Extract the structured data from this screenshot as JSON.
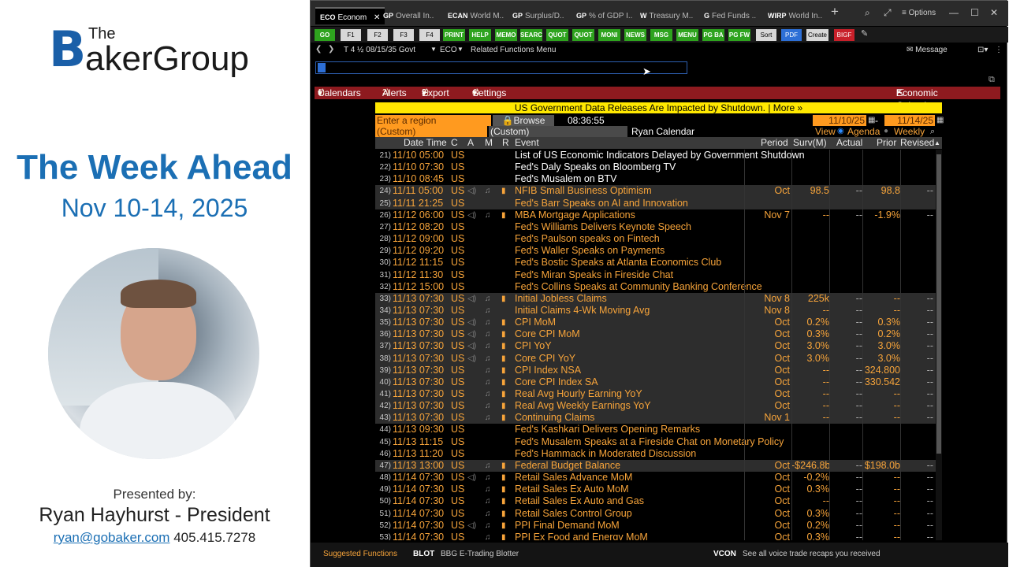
{
  "presentation": {
    "logo_the": "The",
    "logo_b": "B",
    "logo_rest": "akerGroup",
    "title": "The Week Ahead",
    "dates": "Nov 10-14, 2025",
    "presented_by": "Presented by:",
    "presenter": "Ryan Hayhurst - President",
    "email": "ryan@gobaker.com",
    "phone": "405.415.7278"
  },
  "tabs": [
    {
      "code": "ECO",
      "label": "Econom"
    },
    {
      "code": "GP",
      "label": "Overall In.."
    },
    {
      "code": "ECAN",
      "label": "World M.."
    },
    {
      "code": "GP",
      "label": "Surplus/D.."
    },
    {
      "code": "GP",
      "label": "% of GDP I.."
    },
    {
      "code": "W",
      "label": "Treasury M.."
    },
    {
      "code": "G",
      "label": "Fed Funds .."
    },
    {
      "code": "WIRP",
      "label": "World In.."
    }
  ],
  "window": {
    "new_tab": "+",
    "options": "Options",
    "search": "⌕",
    "expand": "⤢",
    "minimize": "—",
    "maximize": "☐",
    "close": "✕",
    "tab_close": "✕"
  },
  "fkeys": [
    "GO",
    "F1",
    "F2",
    "F3",
    "F4",
    "PRINT",
    "HELP",
    "MEMO",
    "SEARC",
    "QUOT",
    "QUOT",
    "MONI",
    "NEWS",
    "MSG",
    "MENU",
    "PG BA",
    "PG FW",
    "Sort",
    "PDF",
    "Create",
    "BIGF"
  ],
  "nav": {
    "security": "T 4 ½ 08/15/35 Govt",
    "function": "ECO",
    "related": "Related Functions Menu",
    "message": "Message"
  },
  "menu": [
    {
      "num": "1)",
      "label": "Calendars"
    },
    {
      "num": "2)",
      "label": "Alerts"
    },
    {
      "num": "3)",
      "label": "Export"
    },
    {
      "num": "4)",
      "label": "Settings"
    }
  ],
  "menu_right": "Economic Calendars",
  "banner": {
    "text": "US Government Data Releases Are Impacted by Shutdown.",
    "more": "| More »"
  },
  "filters": {
    "region_placeholder": "Enter a region",
    "browse": "Browse",
    "time": "08:36:55",
    "start_date": "11/10/25",
    "end_date": "11/14/25",
    "dash": "-",
    "custom1": "(Custom)",
    "custom2": "(Custom)",
    "calendar_name": "Ryan Calendar",
    "view_label": "View",
    "view_agenda": "Agenda",
    "view_weekly": "Weekly"
  },
  "columns": {
    "datetime": "Date Time",
    "c": "C",
    "a": "A",
    "m": "M",
    "r": "R",
    "event": "Event",
    "period": "Period",
    "surv": "Surv(M)",
    "actual": "Actual",
    "prior": "Prior",
    "revised": "Revised"
  },
  "events": [
    {
      "idx": "21)",
      "dt": "11/10 05:00",
      "c": "US",
      "spk": "",
      "bell": "",
      "rel": "",
      "ev": "List of US Economic Indicators Delayed by Government Shutdown",
      "style": "white",
      "per": "",
      "surv": "",
      "act": "",
      "pri": "",
      "rev": "",
      "shade": false
    },
    {
      "idx": "22)",
      "dt": "11/10 07:30",
      "c": "US",
      "spk": "",
      "bell": "",
      "rel": "",
      "ev": "Fed's Daly Speaks on Bloomberg TV",
      "style": "white",
      "per": "",
      "surv": "",
      "act": "",
      "pri": "",
      "rev": "",
      "shade": false
    },
    {
      "idx": "23)",
      "dt": "11/10 08:45",
      "c": "US",
      "spk": "",
      "bell": "",
      "rel": "",
      "ev": "Fed's Musalem on BTV",
      "style": "white",
      "per": "",
      "surv": "",
      "act": "",
      "pri": "",
      "rev": "",
      "shade": false
    },
    {
      "idx": "24)",
      "dt": "11/11 05:00",
      "c": "US",
      "spk": "◁)",
      "bell": "♫",
      "rel": "▮",
      "ev": "NFIB Small Business Optimism",
      "style": "orange",
      "per": "Oct",
      "surv": "98.5",
      "act": "--",
      "pri": "98.8",
      "rev": "--",
      "shade": true
    },
    {
      "idx": "25)",
      "dt": "11/11 21:25",
      "c": "US",
      "spk": "",
      "bell": "",
      "rel": "",
      "ev": "Fed's Barr Speaks on AI and Innovation",
      "style": "orange",
      "per": "",
      "surv": "",
      "act": "",
      "pri": "",
      "rev": "",
      "shade": true
    },
    {
      "idx": "26)",
      "dt": "11/12 06:00",
      "c": "US",
      "spk": "◁)",
      "bell": "♫",
      "rel": "▮",
      "ev": "MBA Mortgage Applications",
      "style": "orange",
      "per": "Nov 7",
      "surv": "--",
      "act": "--",
      "pri": "-1.9%",
      "rev": "--",
      "shade": false
    },
    {
      "idx": "27)",
      "dt": "11/12 08:20",
      "c": "US",
      "spk": "",
      "bell": "",
      "rel": "",
      "ev": "Fed's Williams Delivers Keynote Speech",
      "style": "orange",
      "per": "",
      "surv": "",
      "act": "",
      "pri": "",
      "rev": "",
      "shade": false
    },
    {
      "idx": "28)",
      "dt": "11/12 09:00",
      "c": "US",
      "spk": "",
      "bell": "",
      "rel": "",
      "ev": "Fed's Paulson speaks on Fintech",
      "style": "orange",
      "per": "",
      "surv": "",
      "act": "",
      "pri": "",
      "rev": "",
      "shade": false
    },
    {
      "idx": "29)",
      "dt": "11/12 09:20",
      "c": "US",
      "spk": "",
      "bell": "",
      "rel": "",
      "ev": "Fed's Waller Speaks on Payments",
      "style": "orange",
      "per": "",
      "surv": "",
      "act": "",
      "pri": "",
      "rev": "",
      "shade": false
    },
    {
      "idx": "30)",
      "dt": "11/12 11:15",
      "c": "US",
      "spk": "",
      "bell": "",
      "rel": "",
      "ev": "Fed's Bostic Speaks at Atlanta Economics Club",
      "style": "orange",
      "per": "",
      "surv": "",
      "act": "",
      "pri": "",
      "rev": "",
      "shade": false
    },
    {
      "idx": "31)",
      "dt": "11/12 11:30",
      "c": "US",
      "spk": "",
      "bell": "",
      "rel": "",
      "ev": "Fed's Miran Speaks in Fireside Chat",
      "style": "orange",
      "per": "",
      "surv": "",
      "act": "",
      "pri": "",
      "rev": "",
      "shade": false
    },
    {
      "idx": "32)",
      "dt": "11/12 15:00",
      "c": "US",
      "spk": "",
      "bell": "",
      "rel": "",
      "ev": "Fed's Collins Speaks at Community Banking Conference",
      "style": "orange",
      "per": "",
      "surv": "",
      "act": "",
      "pri": "",
      "rev": "",
      "shade": false
    },
    {
      "idx": "33)",
      "dt": "11/13 07:30",
      "c": "US",
      "spk": "◁)",
      "bell": "♫",
      "rel": "▮",
      "ev": "Initial Jobless Claims",
      "style": "orange",
      "per": "Nov 8",
      "surv": "225k",
      "act": "--",
      "pri": "--",
      "rev": "--",
      "shade": true
    },
    {
      "idx": "34)",
      "dt": "11/13 07:30",
      "c": "US",
      "spk": "",
      "bell": "♫",
      "rel": "",
      "ev": "Initial Claims 4-Wk Moving Avg",
      "style": "orange",
      "per": "Nov 8",
      "surv": "--",
      "act": "--",
      "pri": "--",
      "rev": "--",
      "shade": true
    },
    {
      "idx": "35)",
      "dt": "11/13 07:30",
      "c": "US",
      "spk": "◁)",
      "bell": "♫",
      "rel": "▮",
      "ev": "CPI MoM",
      "style": "orange",
      "per": "Oct",
      "surv": "0.2%",
      "act": "--",
      "pri": "0.3%",
      "rev": "--",
      "shade": true
    },
    {
      "idx": "36)",
      "dt": "11/13 07:30",
      "c": "US",
      "spk": "◁)",
      "bell": "♫",
      "rel": "▮",
      "ev": "Core CPI MoM",
      "style": "orange",
      "per": "Oct",
      "surv": "0.3%",
      "act": "--",
      "pri": "0.2%",
      "rev": "--",
      "shade": true
    },
    {
      "idx": "37)",
      "dt": "11/13 07:30",
      "c": "US",
      "spk": "◁)",
      "bell": "♫",
      "rel": "▮",
      "ev": "CPI YoY",
      "style": "orange",
      "per": "Oct",
      "surv": "3.0%",
      "act": "--",
      "pri": "3.0%",
      "rev": "--",
      "shade": true
    },
    {
      "idx": "38)",
      "dt": "11/13 07:30",
      "c": "US",
      "spk": "◁)",
      "bell": "♫",
      "rel": "▮",
      "ev": "Core CPI YoY",
      "style": "orange",
      "per": "Oct",
      "surv": "3.0%",
      "act": "--",
      "pri": "3.0%",
      "rev": "--",
      "shade": true
    },
    {
      "idx": "39)",
      "dt": "11/13 07:30",
      "c": "US",
      "spk": "",
      "bell": "♫",
      "rel": "▮",
      "ev": "CPI Index NSA",
      "style": "orange",
      "per": "Oct",
      "surv": "--",
      "act": "--",
      "pri": "324.800",
      "rev": "--",
      "shade": true
    },
    {
      "idx": "40)",
      "dt": "11/13 07:30",
      "c": "US",
      "spk": "",
      "bell": "♫",
      "rel": "▮",
      "ev": "Core CPI Index SA",
      "style": "orange",
      "per": "Oct",
      "surv": "--",
      "act": "--",
      "pri": "330.542",
      "rev": "--",
      "shade": true
    },
    {
      "idx": "41)",
      "dt": "11/13 07:30",
      "c": "US",
      "spk": "",
      "bell": "♫",
      "rel": "▮",
      "ev": "Real Avg Hourly Earning YoY",
      "style": "orange",
      "per": "Oct",
      "surv": "--",
      "act": "--",
      "pri": "--",
      "rev": "--",
      "shade": true
    },
    {
      "idx": "42)",
      "dt": "11/13 07:30",
      "c": "US",
      "spk": "",
      "bell": "♫",
      "rel": "▮",
      "ev": "Real Avg Weekly Earnings YoY",
      "style": "orange",
      "per": "Oct",
      "surv": "--",
      "act": "--",
      "pri": "--",
      "rev": "--",
      "shade": true
    },
    {
      "idx": "43)",
      "dt": "11/13 07:30",
      "c": "US",
      "spk": "",
      "bell": "♫",
      "rel": "▮",
      "ev": "Continuing Claims",
      "style": "orange",
      "per": "Nov 1",
      "surv": "--",
      "act": "--",
      "pri": "--",
      "rev": "--",
      "shade": true
    },
    {
      "idx": "44)",
      "dt": "11/13 09:30",
      "c": "US",
      "spk": "",
      "bell": "",
      "rel": "",
      "ev": "Fed's Kashkari Delivers Opening Remarks",
      "style": "orange",
      "per": "",
      "surv": "",
      "act": "",
      "pri": "",
      "rev": "",
      "shade": false
    },
    {
      "idx": "45)",
      "dt": "11/13 11:15",
      "c": "US",
      "spk": "",
      "bell": "",
      "rel": "",
      "ev": "Fed's Musalem Speaks at a Fireside Chat on Monetary Policy",
      "style": "orange",
      "per": "",
      "surv": "",
      "act": "",
      "pri": "",
      "rev": "",
      "shade": false
    },
    {
      "idx": "46)",
      "dt": "11/13 11:20",
      "c": "US",
      "spk": "",
      "bell": "",
      "rel": "",
      "ev": "Fed's Hammack in Moderated Discussion",
      "style": "orange",
      "per": "",
      "surv": "",
      "act": "",
      "pri": "",
      "rev": "",
      "shade": false
    },
    {
      "idx": "47)",
      "dt": "11/13 13:00",
      "c": "US",
      "spk": "",
      "bell": "♫",
      "rel": "▮",
      "ev": "Federal Budget Balance",
      "style": "orange",
      "per": "Oct",
      "surv": "-$246.8b",
      "act": "--",
      "pri": "$198.0b",
      "rev": "--",
      "shade": true
    },
    {
      "idx": "48)",
      "dt": "11/14 07:30",
      "c": "US",
      "spk": "◁)",
      "bell": "♫",
      "rel": "▮",
      "ev": "Retail Sales Advance MoM",
      "style": "orange",
      "per": "Oct",
      "surv": "-0.2%",
      "act": "--",
      "pri": "--",
      "rev": "--",
      "shade": false
    },
    {
      "idx": "49)",
      "dt": "11/14 07:30",
      "c": "US",
      "spk": "",
      "bell": "♫",
      "rel": "▮",
      "ev": "Retail Sales Ex Auto MoM",
      "style": "orange",
      "per": "Oct",
      "surv": "0.3%",
      "act": "--",
      "pri": "--",
      "rev": "--",
      "shade": false
    },
    {
      "idx": "50)",
      "dt": "11/14 07:30",
      "c": "US",
      "spk": "",
      "bell": "♫",
      "rel": "▮",
      "ev": "Retail Sales Ex Auto and Gas",
      "style": "orange",
      "per": "Oct",
      "surv": "--",
      "act": "--",
      "pri": "--",
      "rev": "--",
      "shade": false
    },
    {
      "idx": "51)",
      "dt": "11/14 07:30",
      "c": "US",
      "spk": "",
      "bell": "♫",
      "rel": "▮",
      "ev": "Retail Sales Control Group",
      "style": "orange",
      "per": "Oct",
      "surv": "0.3%",
      "act": "--",
      "pri": "--",
      "rev": "--",
      "shade": false
    },
    {
      "idx": "52)",
      "dt": "11/14 07:30",
      "c": "US",
      "spk": "◁)",
      "bell": "♫",
      "rel": "▮",
      "ev": "PPI Final Demand MoM",
      "style": "orange",
      "per": "Oct",
      "surv": "0.2%",
      "act": "--",
      "pri": "--",
      "rev": "--",
      "shade": false
    },
    {
      "idx": "53)",
      "dt": "11/14 07:30",
      "c": "US",
      "spk": "",
      "bell": "♫",
      "rel": "▮",
      "ev": "PPI Ex Food and Energy MoM",
      "style": "orange",
      "per": "Oct",
      "surv": "0.3%",
      "act": "--",
      "pri": "--",
      "rev": "--",
      "shade": false
    }
  ],
  "footer": {
    "suggested": "Suggested Functions",
    "blot_code": "BLOT",
    "blot_label": "BBG E-Trading Blotter",
    "vcon_code": "VCON",
    "vcon_label": "See all voice trade recaps you received"
  },
  "colors": {
    "accent_blue": "#1b6fb4",
    "terminal_orange": "#f7a43a",
    "banner_yellow": "#ffe800",
    "menu_red": "#8e1a1f"
  }
}
